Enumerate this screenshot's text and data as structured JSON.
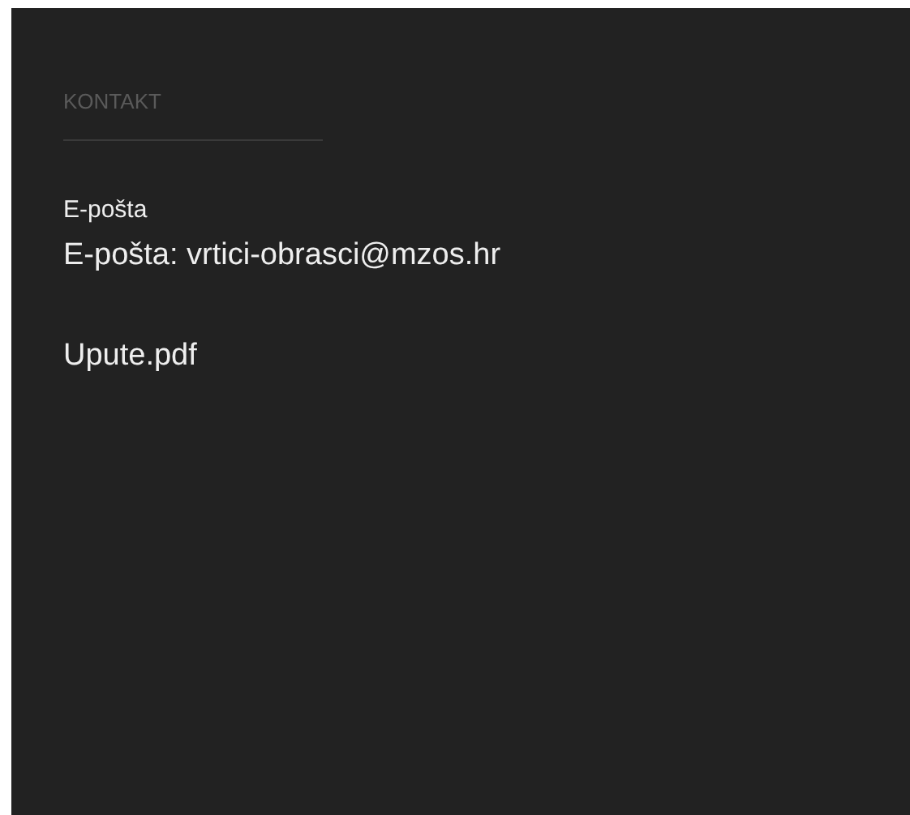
{
  "section": {
    "title": "KONTAKT",
    "email_label": "E-pošta",
    "email_line": "E-pošta: vrtici-obrasci@mzos.hr",
    "attachment": "Upute.pdf"
  }
}
